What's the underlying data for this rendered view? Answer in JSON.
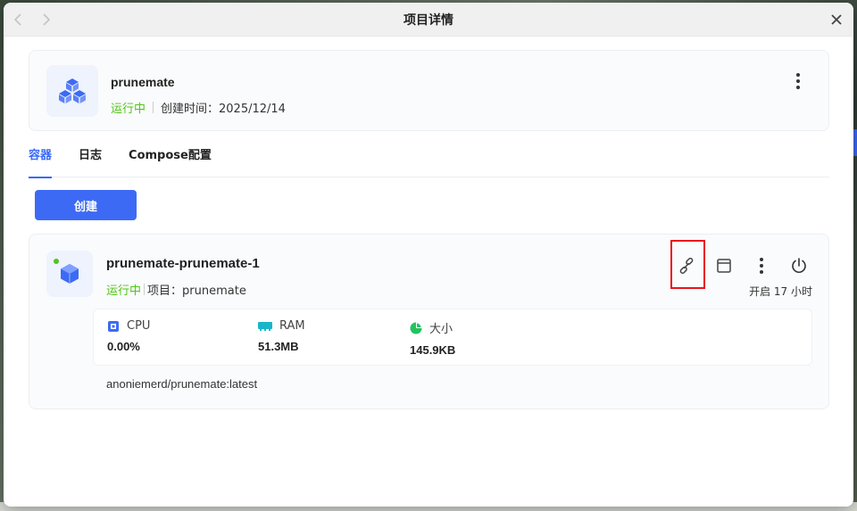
{
  "window": {
    "title": "项目详情",
    "back_icon": "chevron-left-icon",
    "forward_icon": "chevron-right-icon",
    "close_icon": "close-icon"
  },
  "project": {
    "name": "prunemate",
    "status": "运行中",
    "created_label": "创建时间：2025/12/14",
    "icon": "cubes-icon"
  },
  "tabs": [
    {
      "label": "容器",
      "active": true
    },
    {
      "label": "日志",
      "active": false
    },
    {
      "label": "Compose配置",
      "active": false
    }
  ],
  "create_button": {
    "label": "创建"
  },
  "container": {
    "name": "prunemate-prunemate-1",
    "status": "运行中",
    "project_label": "项目：prunemate",
    "uptime": "开启 17 小时",
    "image": "anoniemerd/prunemate:latest",
    "status_color": "#52c41a",
    "stats": {
      "cpu": {
        "label": "CPU",
        "value": "0.00%"
      },
      "ram": {
        "label": "RAM",
        "value": "51.3MB"
      },
      "size": {
        "label": "大小",
        "value": "145.9KB"
      }
    },
    "actions": [
      "link-icon",
      "terminal-window-icon",
      "more-vertical-icon",
      "power-icon"
    ]
  },
  "colors": {
    "accent": "#3d6af5",
    "running": "#52c41a",
    "highlight": "#e8141c"
  }
}
